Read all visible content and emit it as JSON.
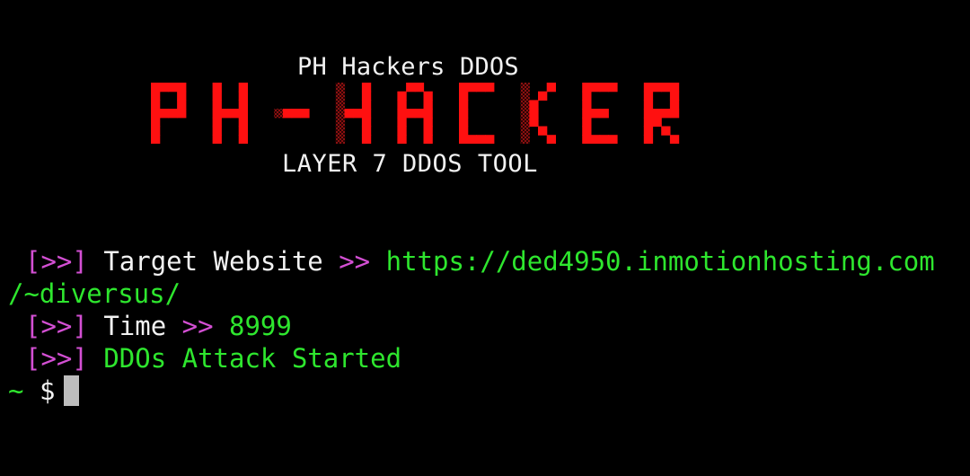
{
  "colors": {
    "background": "#000000",
    "logo_red": "#ff1010",
    "logo_dark": "#4a0808",
    "bracket_magenta": "#d34fd3",
    "text_white": "#f2f2f2",
    "value_green": "#2ee62e",
    "cursor": "#bdbdbd"
  },
  "banner": {
    "title": "PH Hackers DDOS",
    "logo_text": "PH-HACKER",
    "subtitle": "LAYER 7 DDOS TOOL"
  },
  "output": [
    {
      "prefix": "[>>]",
      "label": "Target Website",
      "sep": ">>",
      "value": "https://ded4950.inmotionhosting.com",
      "value_cont": "/~diversus/"
    },
    {
      "prefix": "[>>]",
      "label": "Time",
      "sep": ">>",
      "value": "8999"
    },
    {
      "prefix": "[>>]",
      "message": "DDOs Attack Started"
    }
  ],
  "prompt": {
    "cwd": "~",
    "symbol": "$"
  }
}
